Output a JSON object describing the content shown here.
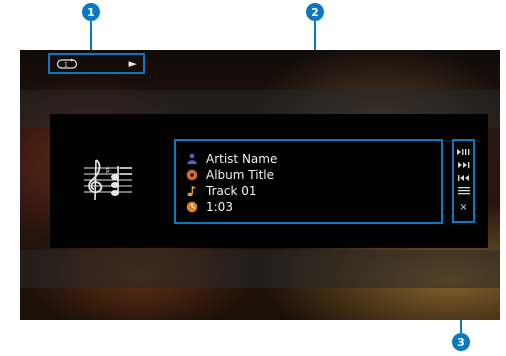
{
  "callouts": {
    "one": "1",
    "two": "2",
    "three": "3"
  },
  "status": {
    "repeat_icon": "repeat-one-icon",
    "play_icon": "play-icon",
    "play_glyph": "►"
  },
  "track": {
    "artist": "Artist Name",
    "album": "Album Title",
    "title": "Track 01",
    "elapsed": "1:03"
  },
  "operations": {
    "close_glyph": "×"
  },
  "colors": {
    "accent": "#0a78c2",
    "panel": "#000000",
    "text": "#f1f1f1"
  }
}
